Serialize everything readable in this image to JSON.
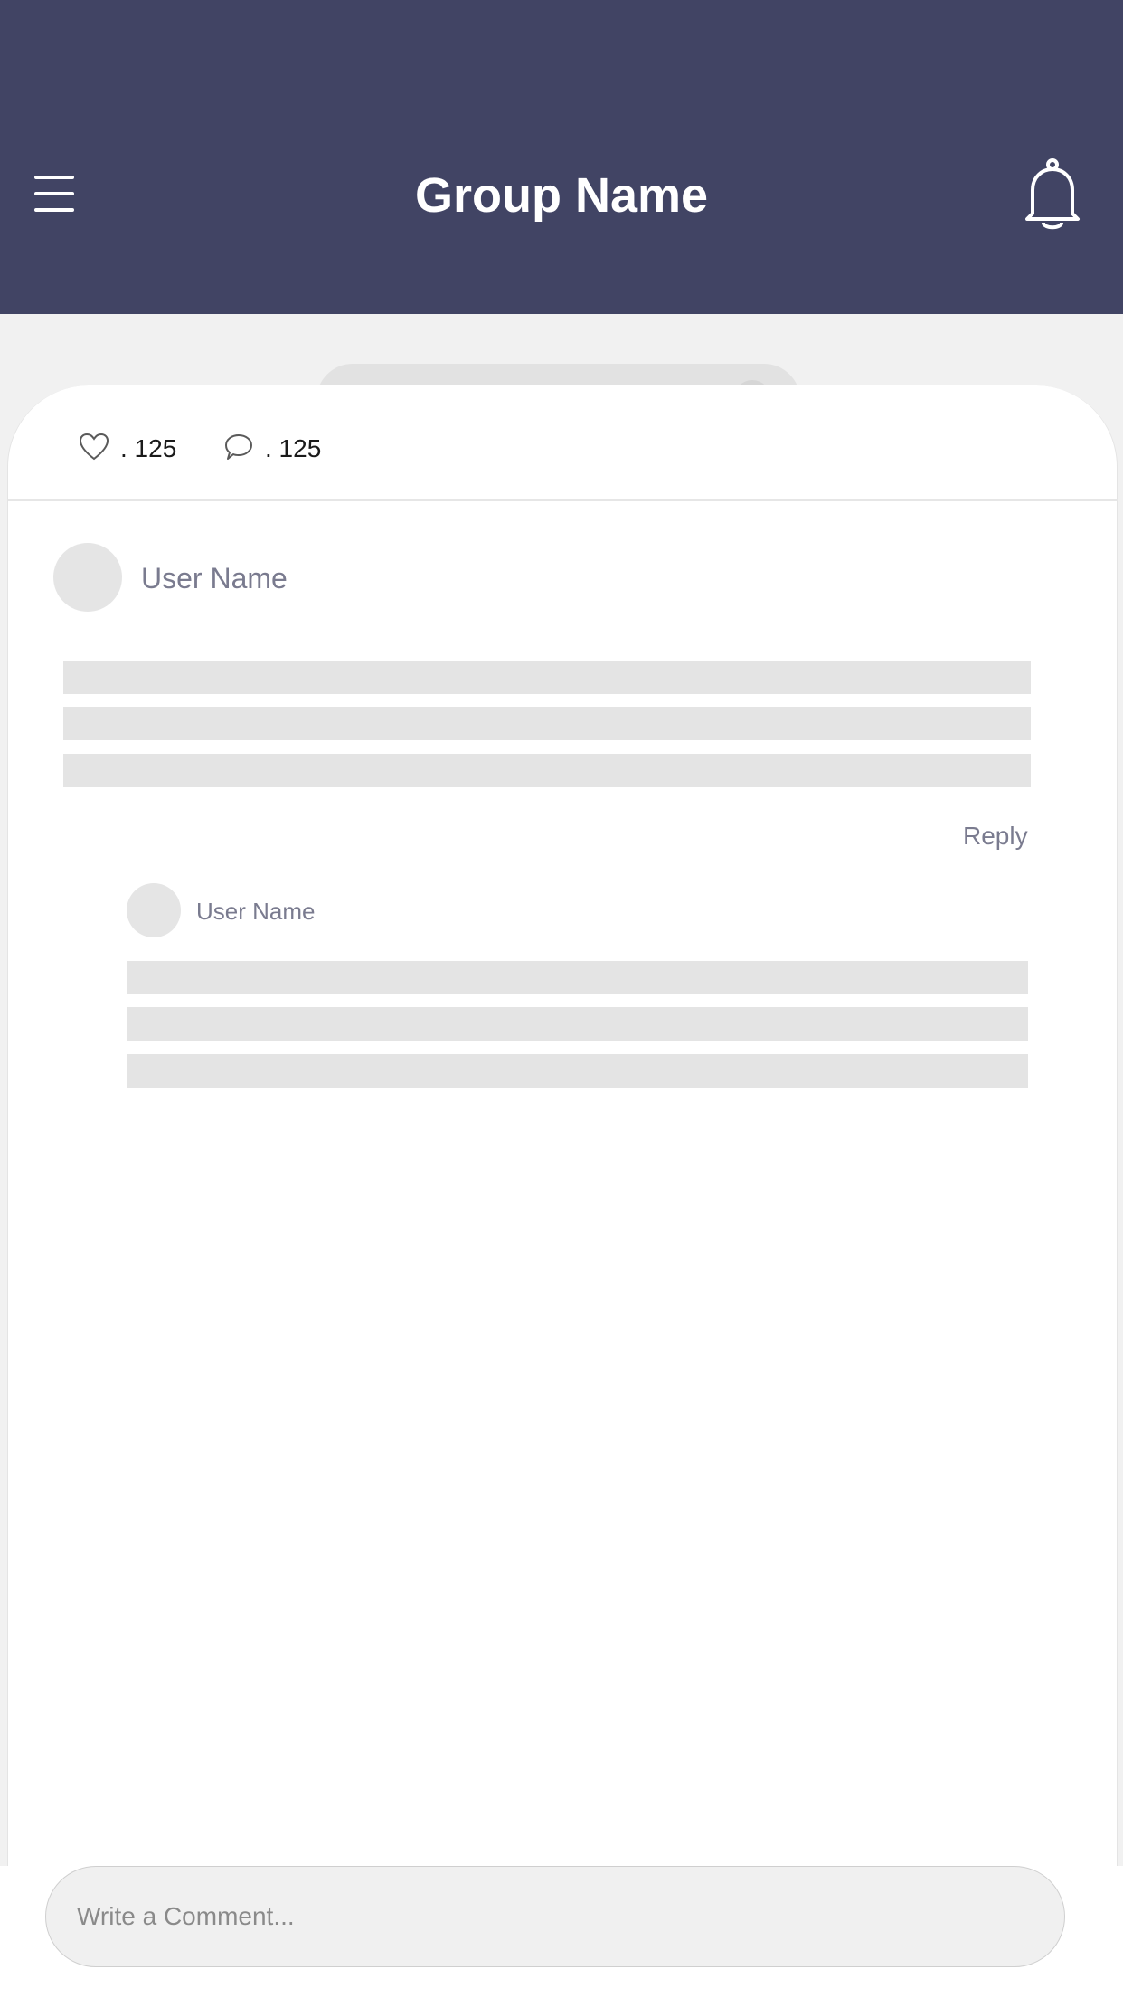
{
  "header": {
    "title": "Group Name",
    "background_color": "#414464",
    "menu_icon": "hamburger-menu-icon",
    "notification_icon": "bell-icon"
  },
  "post_stats": {
    "likes": ". 125",
    "comments": ". 125",
    "like_icon": "heart-icon",
    "comment_icon": "speech-bubble-icon"
  },
  "comment": {
    "user_name": "User Name",
    "reply_label": "Reply"
  },
  "reply_comment": {
    "user_name": "User Name"
  },
  "composer": {
    "placeholder": "Write a Comment..."
  }
}
